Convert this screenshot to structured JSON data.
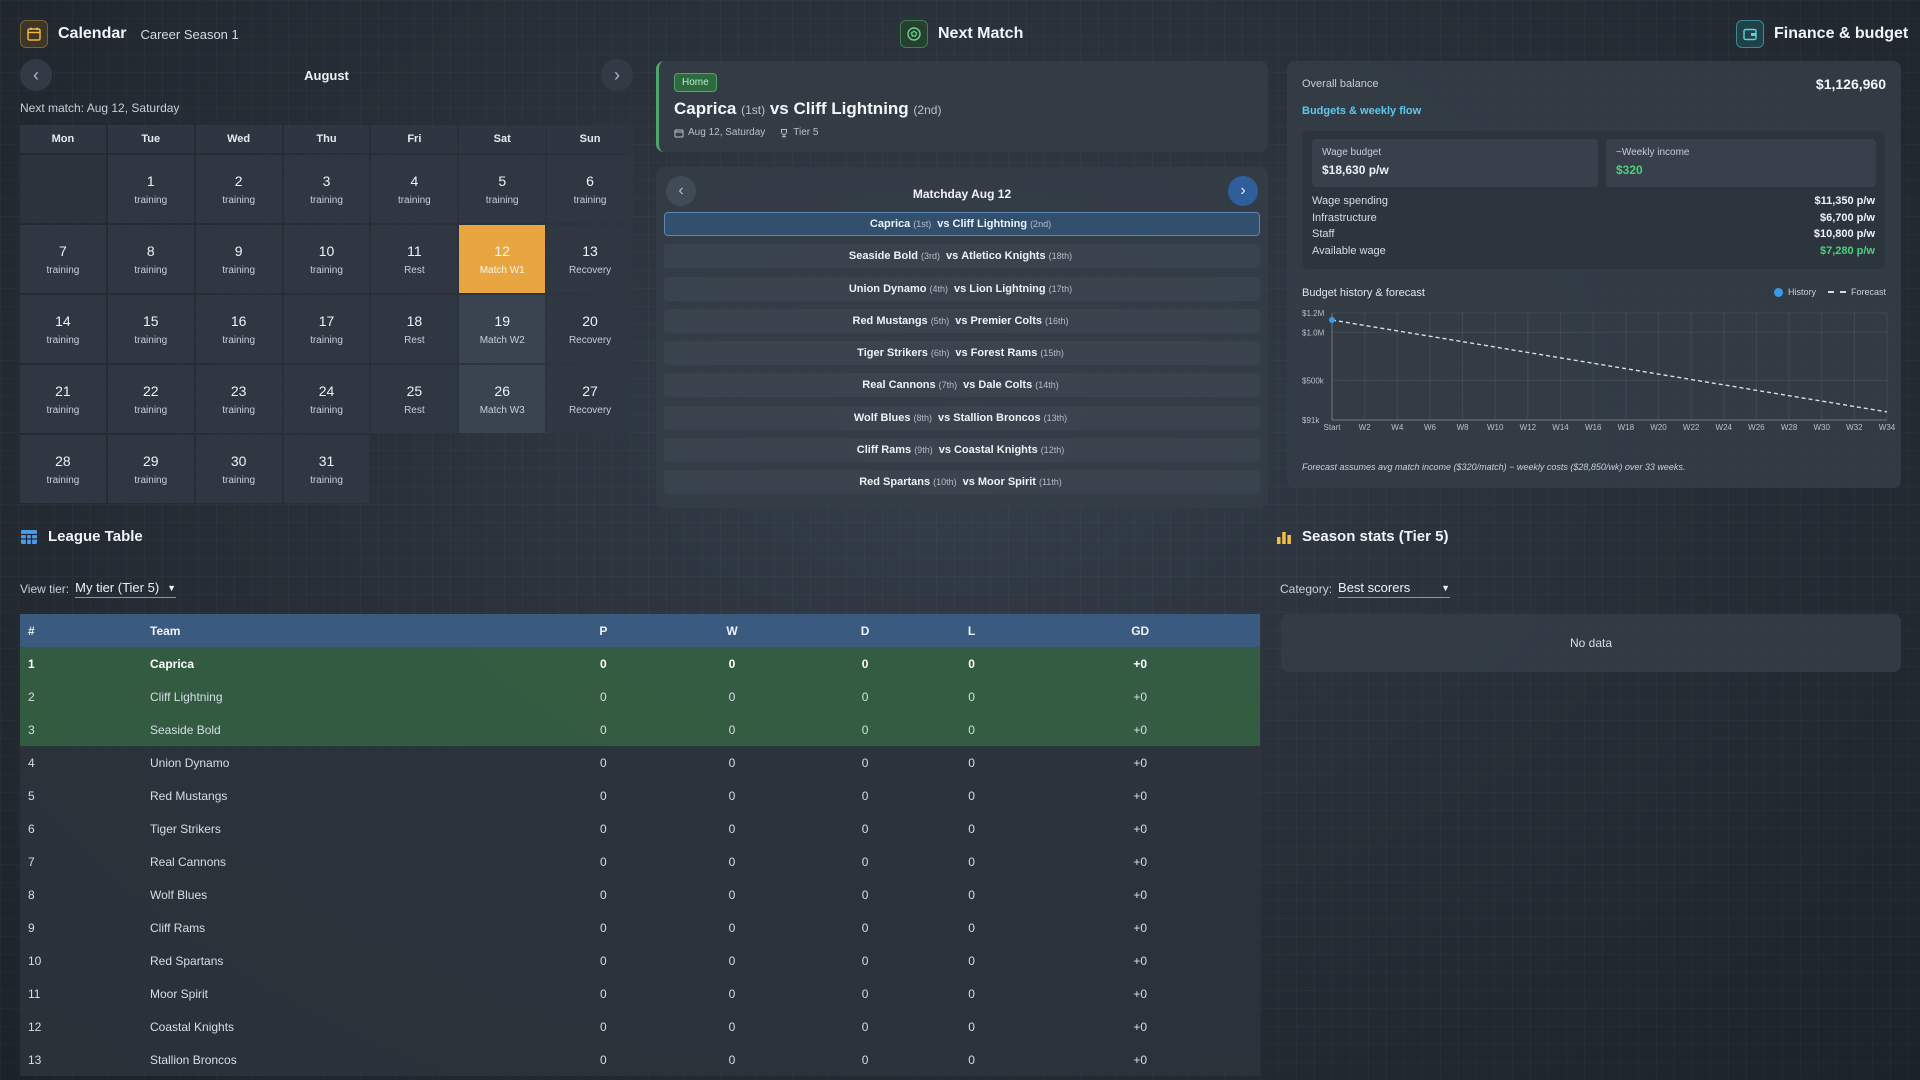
{
  "calendar": {
    "title": "Calendar",
    "season": "Career Season 1",
    "month": "August",
    "next_match_text": "Next match: Aug 12, Saturday",
    "weekdays": [
      "Mon",
      "Tue",
      "Wed",
      "Thu",
      "Fri",
      "Sat",
      "Sun"
    ],
    "weeks": [
      [
        {
          "n": "",
          "t": ""
        },
        {
          "n": "1",
          "t": "training"
        },
        {
          "n": "2",
          "t": "training"
        },
        {
          "n": "3",
          "t": "training"
        },
        {
          "n": "4",
          "t": "training"
        },
        {
          "n": "5",
          "t": "training"
        },
        {
          "n": "6",
          "t": "training"
        }
      ],
      [
        {
          "n": "7",
          "t": "training"
        },
        {
          "n": "8",
          "t": "training"
        },
        {
          "n": "9",
          "t": "training"
        },
        {
          "n": "10",
          "t": "training"
        },
        {
          "n": "11",
          "t": "Rest"
        },
        {
          "n": "12",
          "t": "Match W1",
          "today": true
        },
        {
          "n": "13",
          "t": "Recovery"
        }
      ],
      [
        {
          "n": "14",
          "t": "training"
        },
        {
          "n": "15",
          "t": "training"
        },
        {
          "n": "16",
          "t": "training"
        },
        {
          "n": "17",
          "t": "training"
        },
        {
          "n": "18",
          "t": "Rest"
        },
        {
          "n": "19",
          "t": "Match W2",
          "match": true
        },
        {
          "n": "20",
          "t": "Recovery"
        }
      ],
      [
        {
          "n": "21",
          "t": "training"
        },
        {
          "n": "22",
          "t": "training"
        },
        {
          "n": "23",
          "t": "training"
        },
        {
          "n": "24",
          "t": "training"
        },
        {
          "n": "25",
          "t": "Rest"
        },
        {
          "n": "26",
          "t": "Match W3",
          "match": true
        },
        {
          "n": "27",
          "t": "Recovery"
        }
      ],
      [
        {
          "n": "28",
          "t": "training"
        },
        {
          "n": "29",
          "t": "training"
        },
        {
          "n": "30",
          "t": "training"
        },
        {
          "n": "31",
          "t": "training"
        }
      ]
    ]
  },
  "next_match": {
    "title": "Next Match",
    "badge": "Home",
    "home": "Caprica",
    "home_pos": "(1st)",
    "vs": "vs",
    "away": "Cliff Lightning",
    "away_pos": "(2nd)",
    "date": "Aug 12, Saturday",
    "tier": "Tier 5",
    "matchday_title": "Matchday Aug 12",
    "fixtures": [
      {
        "home": "Caprica",
        "hp": "(1st)",
        "away": "Cliff Lightning",
        "ap": "(2nd)"
      },
      {
        "home": "Seaside Bold",
        "hp": "(3rd)",
        "away": "Atletico Knights",
        "ap": "(18th)"
      },
      {
        "home": "Union Dynamo",
        "hp": "(4th)",
        "away": "Lion Lightning",
        "ap": "(17th)"
      },
      {
        "home": "Red Mustangs",
        "hp": "(5th)",
        "away": "Premier Colts",
        "ap": "(16th)"
      },
      {
        "home": "Tiger Strikers",
        "hp": "(6th)",
        "away": "Forest Rams",
        "ap": "(15th)"
      },
      {
        "home": "Real Cannons",
        "hp": "(7th)",
        "away": "Dale Colts",
        "ap": "(14th)"
      },
      {
        "home": "Wolf Blues",
        "hp": "(8th)",
        "away": "Stallion Broncos",
        "ap": "(13th)"
      },
      {
        "home": "Cliff Rams",
        "hp": "(9th)",
        "away": "Coastal Knights",
        "ap": "(12th)"
      },
      {
        "home": "Red Spartans",
        "hp": "(10th)",
        "away": "Moor Spirit",
        "ap": "(11th)"
      }
    ]
  },
  "finance": {
    "title": "Finance & budget",
    "overall_label": "Overall balance",
    "overall_value": "$1,126,960",
    "budgets_link": "Budgets & weekly flow",
    "wage_budget_label": "Wage budget",
    "wage_budget_value": "$18,630 p/w",
    "weekly_income_label": "~Weekly income",
    "weekly_income_value": "$320",
    "rows": [
      {
        "label": "Wage spending",
        "value": "$11,350 p/w"
      },
      {
        "label": "Infrastructure",
        "value": "$6,700 p/w"
      },
      {
        "label": "Staff",
        "value": "$10,800 p/w"
      },
      {
        "label": "Available wage",
        "value": "$7,280 p/w",
        "positive": true
      }
    ],
    "history_title": "Budget history & forecast",
    "legend_history": "History",
    "legend_forecast": "Forecast",
    "forecast_note": "Forecast assumes avg match income ($320/match) − weekly costs ($28,850/wk) over 33 weeks.",
    "colors": {
      "history": "#3b9ae8",
      "forecast": "#d8dee6",
      "positive": "#4cd07a",
      "link": "#5ec8f0"
    }
  },
  "chart_data": {
    "type": "line",
    "x": [
      "Start",
      "W2",
      "W4",
      "W6",
      "W8",
      "W10",
      "W12",
      "W14",
      "W16",
      "W18",
      "W20",
      "W22",
      "W24",
      "W26",
      "W28",
      "W30",
      "W32",
      "W34"
    ],
    "ytick_labels": [
      "$91k",
      "$500k",
      "$1.0M",
      "$1.2M"
    ],
    "ytick_values": [
      91000,
      500000,
      1000000,
      1200000
    ],
    "ylim": [
      91000,
      1200000
    ],
    "series": [
      {
        "name": "History",
        "x": [
          "Start"
        ],
        "values": [
          1126960
        ]
      },
      {
        "name": "Forecast",
        "x": [
          "Start",
          "W34"
        ],
        "values": [
          1126960,
          175000
        ]
      }
    ],
    "grid": true,
    "legend": "top-right"
  },
  "league": {
    "title": "League Table",
    "view_label": "View tier:",
    "view_value": "My tier (Tier 5)",
    "columns": [
      "#",
      "Team",
      "P",
      "W",
      "D",
      "L",
      "GD"
    ],
    "rows": [
      [
        "1",
        "Caprica",
        "0",
        "0",
        "0",
        "0",
        "+0"
      ],
      [
        "2",
        "Cliff Lightning",
        "0",
        "0",
        "0",
        "0",
        "+0"
      ],
      [
        "3",
        "Seaside Bold",
        "0",
        "0",
        "0",
        "0",
        "+0"
      ],
      [
        "4",
        "Union Dynamo",
        "0",
        "0",
        "0",
        "0",
        "+0"
      ],
      [
        "5",
        "Red Mustangs",
        "0",
        "0",
        "0",
        "0",
        "+0"
      ],
      [
        "6",
        "Tiger Strikers",
        "0",
        "0",
        "0",
        "0",
        "+0"
      ],
      [
        "7",
        "Real Cannons",
        "0",
        "0",
        "0",
        "0",
        "+0"
      ],
      [
        "8",
        "Wolf Blues",
        "0",
        "0",
        "0",
        "0",
        "+0"
      ],
      [
        "9",
        "Cliff Rams",
        "0",
        "0",
        "0",
        "0",
        "+0"
      ],
      [
        "10",
        "Red Spartans",
        "0",
        "0",
        "0",
        "0",
        "+0"
      ],
      [
        "11",
        "Moor Spirit",
        "0",
        "0",
        "0",
        "0",
        "+0"
      ],
      [
        "12",
        "Coastal Knights",
        "0",
        "0",
        "0",
        "0",
        "+0"
      ],
      [
        "13",
        "Stallion Broncos",
        "0",
        "0",
        "0",
        "0",
        "+0"
      ]
    ],
    "promotion_rows": 3
  },
  "season_stats": {
    "title": "Season stats (Tier 5)",
    "category_label": "Category:",
    "category_value": "Best scorers",
    "empty_text": "No data"
  }
}
